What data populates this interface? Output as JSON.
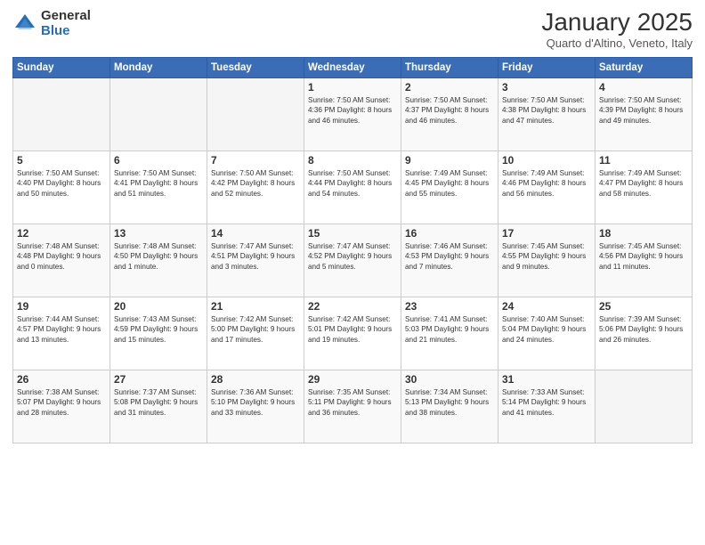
{
  "header": {
    "logo_general": "General",
    "logo_blue": "Blue",
    "month_title": "January 2025",
    "location": "Quarto d'Altino, Veneto, Italy"
  },
  "weekdays": [
    "Sunday",
    "Monday",
    "Tuesday",
    "Wednesday",
    "Thursday",
    "Friday",
    "Saturday"
  ],
  "weeks": [
    [
      {
        "day": "",
        "info": ""
      },
      {
        "day": "",
        "info": ""
      },
      {
        "day": "",
        "info": ""
      },
      {
        "day": "1",
        "info": "Sunrise: 7:50 AM\nSunset: 4:36 PM\nDaylight: 8 hours and 46 minutes."
      },
      {
        "day": "2",
        "info": "Sunrise: 7:50 AM\nSunset: 4:37 PM\nDaylight: 8 hours and 46 minutes."
      },
      {
        "day": "3",
        "info": "Sunrise: 7:50 AM\nSunset: 4:38 PM\nDaylight: 8 hours and 47 minutes."
      },
      {
        "day": "4",
        "info": "Sunrise: 7:50 AM\nSunset: 4:39 PM\nDaylight: 8 hours and 49 minutes."
      }
    ],
    [
      {
        "day": "5",
        "info": "Sunrise: 7:50 AM\nSunset: 4:40 PM\nDaylight: 8 hours and 50 minutes."
      },
      {
        "day": "6",
        "info": "Sunrise: 7:50 AM\nSunset: 4:41 PM\nDaylight: 8 hours and 51 minutes."
      },
      {
        "day": "7",
        "info": "Sunrise: 7:50 AM\nSunset: 4:42 PM\nDaylight: 8 hours and 52 minutes."
      },
      {
        "day": "8",
        "info": "Sunrise: 7:50 AM\nSunset: 4:44 PM\nDaylight: 8 hours and 54 minutes."
      },
      {
        "day": "9",
        "info": "Sunrise: 7:49 AM\nSunset: 4:45 PM\nDaylight: 8 hours and 55 minutes."
      },
      {
        "day": "10",
        "info": "Sunrise: 7:49 AM\nSunset: 4:46 PM\nDaylight: 8 hours and 56 minutes."
      },
      {
        "day": "11",
        "info": "Sunrise: 7:49 AM\nSunset: 4:47 PM\nDaylight: 8 hours and 58 minutes."
      }
    ],
    [
      {
        "day": "12",
        "info": "Sunrise: 7:48 AM\nSunset: 4:48 PM\nDaylight: 9 hours and 0 minutes."
      },
      {
        "day": "13",
        "info": "Sunrise: 7:48 AM\nSunset: 4:50 PM\nDaylight: 9 hours and 1 minute."
      },
      {
        "day": "14",
        "info": "Sunrise: 7:47 AM\nSunset: 4:51 PM\nDaylight: 9 hours and 3 minutes."
      },
      {
        "day": "15",
        "info": "Sunrise: 7:47 AM\nSunset: 4:52 PM\nDaylight: 9 hours and 5 minutes."
      },
      {
        "day": "16",
        "info": "Sunrise: 7:46 AM\nSunset: 4:53 PM\nDaylight: 9 hours and 7 minutes."
      },
      {
        "day": "17",
        "info": "Sunrise: 7:45 AM\nSunset: 4:55 PM\nDaylight: 9 hours and 9 minutes."
      },
      {
        "day": "18",
        "info": "Sunrise: 7:45 AM\nSunset: 4:56 PM\nDaylight: 9 hours and 11 minutes."
      }
    ],
    [
      {
        "day": "19",
        "info": "Sunrise: 7:44 AM\nSunset: 4:57 PM\nDaylight: 9 hours and 13 minutes."
      },
      {
        "day": "20",
        "info": "Sunrise: 7:43 AM\nSunset: 4:59 PM\nDaylight: 9 hours and 15 minutes."
      },
      {
        "day": "21",
        "info": "Sunrise: 7:42 AM\nSunset: 5:00 PM\nDaylight: 9 hours and 17 minutes."
      },
      {
        "day": "22",
        "info": "Sunrise: 7:42 AM\nSunset: 5:01 PM\nDaylight: 9 hours and 19 minutes."
      },
      {
        "day": "23",
        "info": "Sunrise: 7:41 AM\nSunset: 5:03 PM\nDaylight: 9 hours and 21 minutes."
      },
      {
        "day": "24",
        "info": "Sunrise: 7:40 AM\nSunset: 5:04 PM\nDaylight: 9 hours and 24 minutes."
      },
      {
        "day": "25",
        "info": "Sunrise: 7:39 AM\nSunset: 5:06 PM\nDaylight: 9 hours and 26 minutes."
      }
    ],
    [
      {
        "day": "26",
        "info": "Sunrise: 7:38 AM\nSunset: 5:07 PM\nDaylight: 9 hours and 28 minutes."
      },
      {
        "day": "27",
        "info": "Sunrise: 7:37 AM\nSunset: 5:08 PM\nDaylight: 9 hours and 31 minutes."
      },
      {
        "day": "28",
        "info": "Sunrise: 7:36 AM\nSunset: 5:10 PM\nDaylight: 9 hours and 33 minutes."
      },
      {
        "day": "29",
        "info": "Sunrise: 7:35 AM\nSunset: 5:11 PM\nDaylight: 9 hours and 36 minutes."
      },
      {
        "day": "30",
        "info": "Sunrise: 7:34 AM\nSunset: 5:13 PM\nDaylight: 9 hours and 38 minutes."
      },
      {
        "day": "31",
        "info": "Sunrise: 7:33 AM\nSunset: 5:14 PM\nDaylight: 9 hours and 41 minutes."
      },
      {
        "day": "",
        "info": ""
      }
    ]
  ]
}
